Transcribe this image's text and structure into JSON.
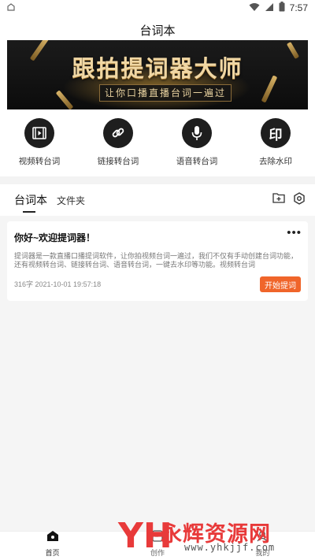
{
  "status_bar": {
    "time": "7:57"
  },
  "header": {
    "title": "台词本"
  },
  "banner": {
    "headline": "跟拍提词器大师",
    "subline": "让你口播直播台词一遍过"
  },
  "features": [
    {
      "label": "视频转台词",
      "icon": "film-icon"
    },
    {
      "label": "链接转台词",
      "icon": "link-icon"
    },
    {
      "label": "语音转台词",
      "icon": "microphone-icon"
    },
    {
      "label": "去除水印",
      "icon": "seal-icon",
      "glyph": "印"
    }
  ],
  "tabs": [
    {
      "label": "台词本",
      "active": true
    },
    {
      "label": "文件夹",
      "active": false
    }
  ],
  "script_card": {
    "title": "你好~欢迎提词器！",
    "more": "•••",
    "body": "提词器是一款直播口播提词软件，让你拍视频台词一遍过，我们不仅有手动创建台词功能，还有视频转台词、链接转台词、语音转台词，一键去水印等功能。视频转台词",
    "meta": "316字 2021-10-01 19:57:18",
    "start_label": "开始提词"
  },
  "bottom_nav": [
    {
      "label": "首页",
      "active": true
    },
    {
      "label": "创作",
      "active": false
    },
    {
      "label": "我的",
      "active": false
    }
  ],
  "watermark": {
    "mark": "YH",
    "name": "永辉资源网",
    "url": "www.yhkjjf.com"
  },
  "colors": {
    "accent": "#f0652a",
    "banner_gold": "#f0d7a4",
    "watermark_red": "#e83a3a"
  }
}
